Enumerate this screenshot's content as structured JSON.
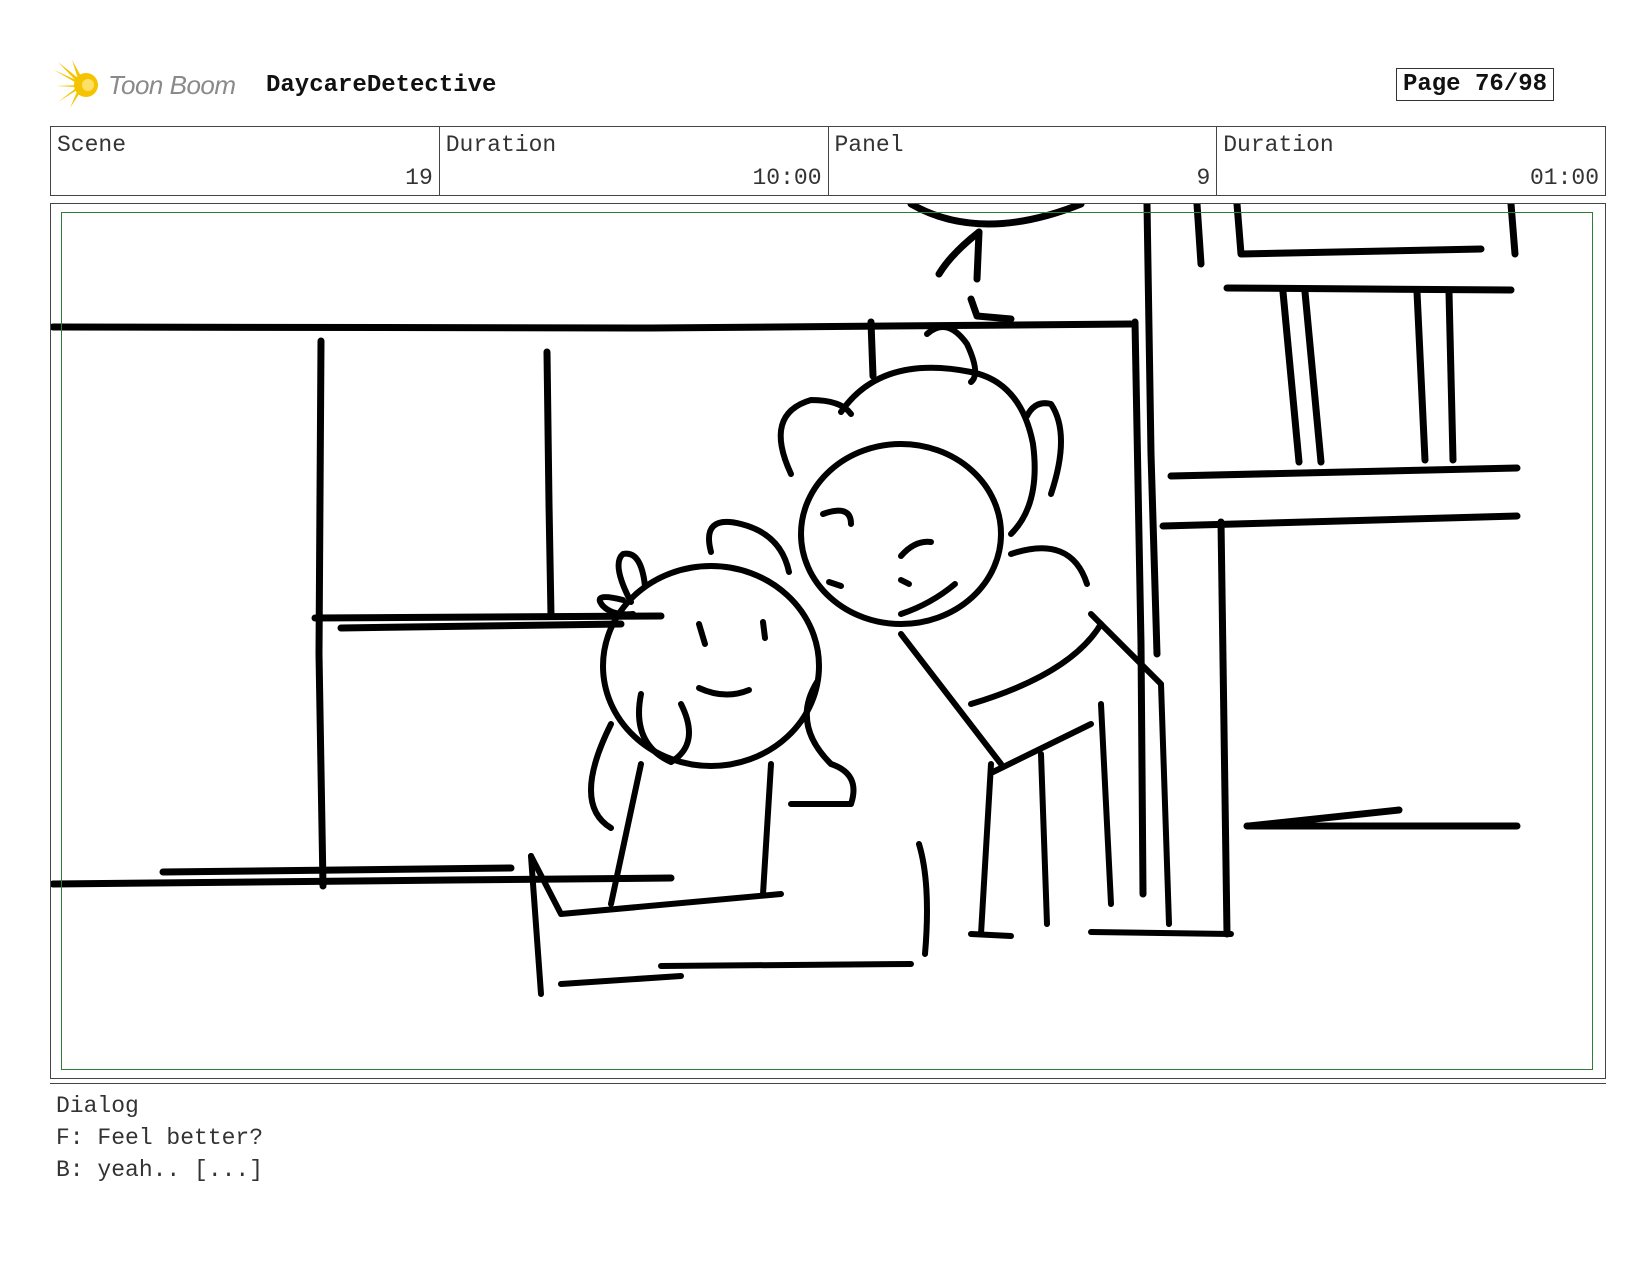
{
  "header": {
    "logo_text": "Toon Boom",
    "logo_icon": "starburst-logo-icon",
    "project_title": "DaycareDetective",
    "page_label": "Page 76/98"
  },
  "info": {
    "scene_label": "Scene",
    "scene_value": "19",
    "scene_duration_label": "Duration",
    "scene_duration_value": "10:00",
    "panel_label": "Panel",
    "panel_value": "9",
    "panel_duration_label": "Duration",
    "panel_duration_value": "01:00"
  },
  "colors": {
    "safe_area_border": "#2e7d32",
    "logo_yellow": "#f5c400",
    "sketch_ink": "#000000"
  },
  "dialog": {
    "label": "Dialog",
    "lines": [
      "F: Feel better?",
      "B: yeah.. [...]"
    ]
  }
}
